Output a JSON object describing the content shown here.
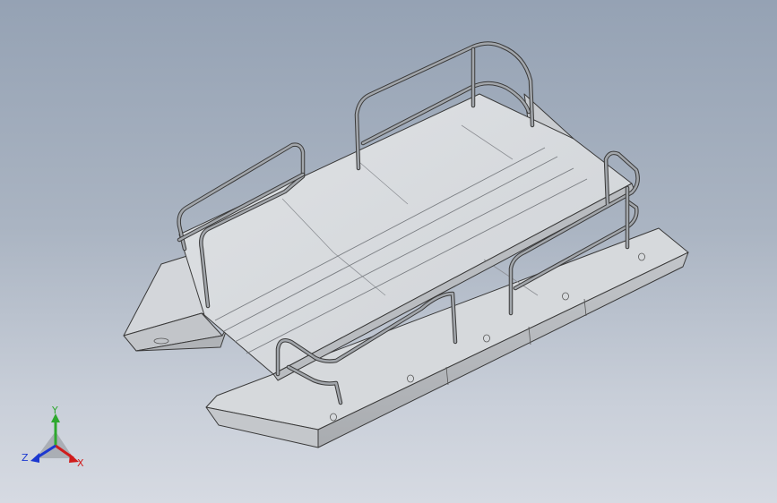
{
  "viewport": {
    "model": "pontoon-platform-assembly",
    "background_top": "#95a2b4",
    "background_bottom": "#d6dae2"
  },
  "triad": {
    "x_label": "X",
    "y_label": "Y",
    "z_label": "Z",
    "x_color": "#d01c1c",
    "y_color": "#2ea82e",
    "z_color": "#1c38d0"
  },
  "colors": {
    "deck_light": "#d9dcdf",
    "deck_shadow": "#c4c7cb",
    "pontoon_side": "#b4b7bb",
    "pontoon_end": "#c6c9cd",
    "rail": "#8d9196",
    "edge": "#3a3a3a"
  }
}
